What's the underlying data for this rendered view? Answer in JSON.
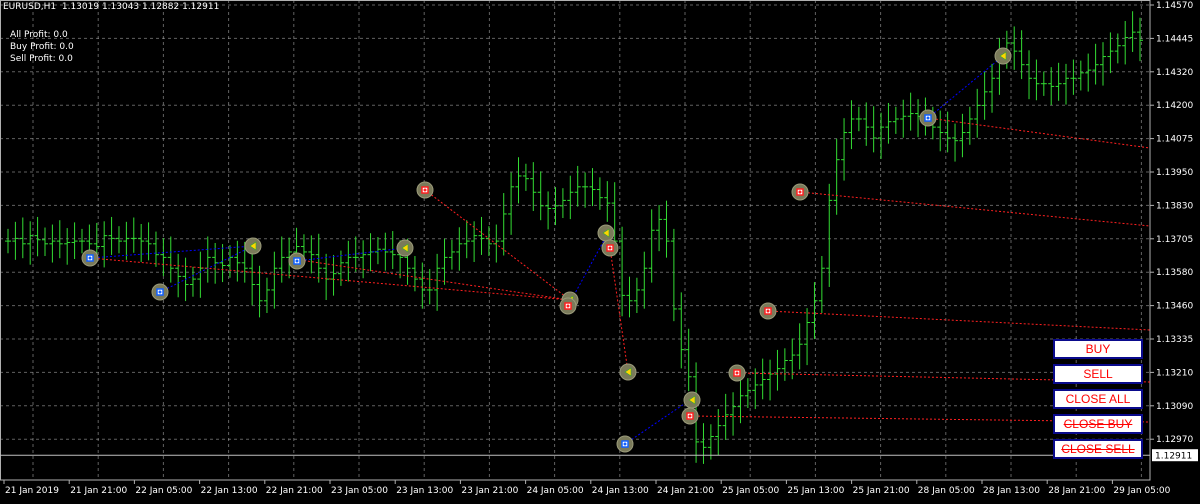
{
  "header": {
    "symbol": "EURUSD,H1",
    "ohlc": "1.13019 1.13043 1.12882 1.12911"
  },
  "profit": {
    "all": "All Profit: 0.0",
    "buy": "Buy Profit: 0.0",
    "sell": "Sell Profit: 0.0"
  },
  "buttons": {
    "buy": "BUY",
    "sell": "SELL",
    "close_all": "CLOSE ALL",
    "close_buy": "CLOSE BUY",
    "close_sell": "CLOSE SELL"
  },
  "price_axis": {
    "ticks": [
      "1.14570",
      "1.14445",
      "1.14320",
      "1.14200",
      "1.14075",
      "1.13950",
      "1.13830",
      "1.13705",
      "1.13580",
      "1.13460",
      "1.13335",
      "1.13210",
      "1.13090",
      "1.12970"
    ],
    "current_price": "1.12911"
  },
  "time_axis": {
    "ticks": [
      "21 Jan 2019",
      "21 Jan 21:00",
      "22 Jan 05:00",
      "22 Jan 13:00",
      "22 Jan 21:00",
      "23 Jan 05:00",
      "23 Jan 13:00",
      "23 Jan 21:00",
      "24 Jan 05:00",
      "24 Jan 13:00",
      "24 Jan 21:00",
      "25 Jan 05:00",
      "25 Jan 13:00",
      "25 Jan 21:00",
      "28 Jan 05:00",
      "28 Jan 13:00",
      "28 Jan 21:00",
      "29 Jan 05:00"
    ]
  },
  "colors": {
    "background": "#000000",
    "grid": "#b0b0b0",
    "bars": "#33dd33",
    "buy_line": "#0000ff",
    "sell_line": "#ff2020",
    "text": "#ffffff",
    "button_border": "#0a0a8c",
    "button_text": "#ff0000"
  },
  "chart_data": {
    "type": "ohlc",
    "bars": [
      1.137,
      1.1371,
      1.1369,
      1.1372,
      1.13705,
      1.1369,
      1.137,
      1.1369,
      1.13695,
      1.137,
      1.137,
      1.1369,
      1.1368,
      1.1372,
      1.1371,
      1.137,
      1.1371,
      1.1371,
      1.137,
      1.1369,
      1.1365,
      1.1364,
      1.136,
      1.1357,
      1.1354,
      1.1356,
      1.136,
      1.1364,
      1.1362,
      1.1361,
      1.1364,
      1.1362,
      1.136,
      1.1354,
      1.1348,
      1.1352,
      1.136,
      1.1364,
      1.1366,
      1.1368,
      1.1366,
      1.1365,
      1.136,
      1.1356,
      1.1358,
      1.1362,
      1.1364,
      1.1364,
      1.1365,
      1.1366,
      1.1367,
      1.1366,
      1.1365,
      1.1364,
      1.136,
      1.1356,
      1.1352,
      1.1352,
      1.136,
      1.1364,
      1.1366,
      1.1369,
      1.137,
      1.1372,
      1.1371,
      1.1369,
      1.137,
      1.138,
      1.139,
      1.1394,
      1.1393,
      1.1388,
      1.1383,
      1.1382,
      1.1383,
      1.1385,
      1.1388,
      1.139,
      1.139,
      1.1389,
      1.1386,
      1.1384,
      1.137,
      1.135,
      1.1348,
      1.1352,
      1.136,
      1.1374,
      1.1378,
      1.137,
      1.1345,
      1.133,
      1.132,
      1.1296,
      1.1294,
      1.1298,
      1.1302,
      1.1306,
      1.1309,
      1.1313,
      1.1315,
      1.1317,
      1.1319,
      1.1321,
      1.1323,
      1.1326,
      1.1328,
      1.1332,
      1.134,
      1.1348,
      1.136,
      1.1385,
      1.14,
      1.141,
      1.1415,
      1.1415,
      1.1412,
      1.1408,
      1.1412,
      1.1414,
      1.1415,
      1.1416,
      1.1417,
      1.1416,
      1.1415,
      1.1412,
      1.141,
      1.1408,
      1.1407,
      1.141,
      1.1415,
      1.142,
      1.1425,
      1.143,
      1.1438,
      1.1443,
      1.144,
      1.1435,
      1.143,
      1.1428,
      1.1428,
      1.1427,
      1.1428,
      1.143,
      1.143,
      1.1432,
      1.1433,
      1.1435,
      1.1438,
      1.144,
      1.1442,
      1.1445,
      1.1447,
      1.1444
    ],
    "ylim": [
      1.1285,
      1.146
    ],
    "current_price": 1.12911,
    "title": "EURUSD,H1"
  }
}
